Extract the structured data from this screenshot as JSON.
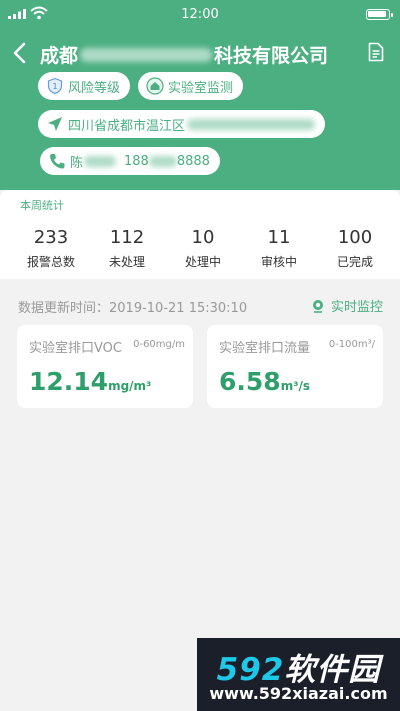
{
  "status_bar": {
    "time": "12:00"
  },
  "header": {
    "title_start": "成都",
    "title_end": "科技有限公司",
    "tags": {
      "risk": "风险等级",
      "lab": "实验室监测"
    },
    "address_start": "四川省成都市温江区",
    "contact": {
      "name_start": "陈",
      "phone_start": "188",
      "phone_end": "8888"
    }
  },
  "stats": {
    "title": "本周统计",
    "items": [
      {
        "value": "233",
        "label": "报警总数"
      },
      {
        "value": "112",
        "label": "未处理"
      },
      {
        "value": "10",
        "label": "处理中"
      },
      {
        "value": "11",
        "label": "审核中"
      },
      {
        "value": "100",
        "label": "已完成"
      }
    ]
  },
  "update": {
    "label": "数据更新时间：",
    "time": "2019-10-21  15:30:10",
    "monitor_label": "实时监控"
  },
  "cards": [
    {
      "name": "实验室排口VOC",
      "range": "0-60mg/m",
      "value": "12.14",
      "unit": "mg/m³"
    },
    {
      "name": "实验室排口流量",
      "range": "0-100m³/",
      "value": "6.58",
      "unit": "m³/s"
    }
  ],
  "watermark": {
    "num": "592",
    "cn": "软件园",
    "url": "www.592xiazai.com"
  },
  "colors": {
    "brand": "#4caf82",
    "value": "#2e9e6a",
    "background": "#f2f2f2"
  }
}
